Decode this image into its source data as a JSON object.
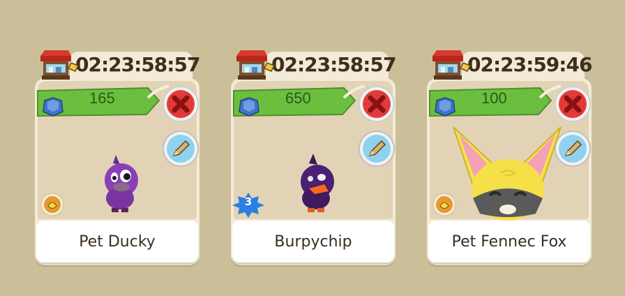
{
  "cards": [
    {
      "timer": "02:23:58:57",
      "price": "165",
      "name": "Pet Ducky",
      "badge": "food"
    },
    {
      "timer": "02:23:58:57",
      "price": "650",
      "name": "Burpychip",
      "badge": "level",
      "level": "3"
    },
    {
      "timer": "02:23:59:46",
      "price": "100",
      "name": "Pet Fennec Fox",
      "badge": "food"
    }
  ],
  "icons": {
    "shop": "shop-stand-icon",
    "currency": "sapphire-gem-icon",
    "delete": "close-icon",
    "edit": "pencil-icon",
    "food": "food-icon",
    "level": "level-star-badge"
  },
  "colors": {
    "background": "#cbbf99",
    "price_tag": "#6abf3f",
    "delete_button": "#e23a3a",
    "edit_button": "#8fd1ee",
    "level_badge": "#2a7fe0"
  }
}
